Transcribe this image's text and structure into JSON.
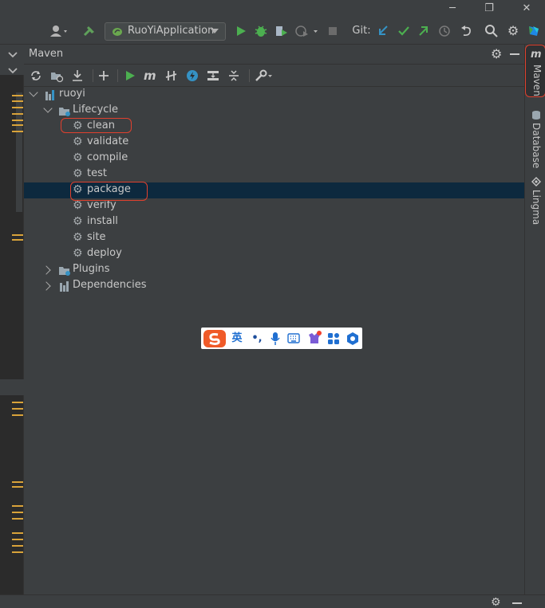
{
  "window": {
    "minimize_glyph": "─",
    "restore_glyph": "❐",
    "close_glyph": "✕"
  },
  "toolbar": {
    "run_config_label": "RuoYiApplication",
    "git_label": "Git:"
  },
  "tool_window": {
    "title": "Maven"
  },
  "tree": {
    "root": "ruoyi",
    "lifecycle": "Lifecycle",
    "goals": [
      "clean",
      "validate",
      "compile",
      "test",
      "package",
      "verify",
      "install",
      "site",
      "deploy"
    ],
    "plugins": "Plugins",
    "dependencies": "Dependencies",
    "selected_goal": "package"
  },
  "right_strip": {
    "tabs": [
      "Maven",
      "Database",
      "Lingma"
    ]
  },
  "ime": {
    "lang": "英",
    "punct": "•,"
  },
  "colors": {
    "accent_run": "#4caf50",
    "selection": "#0d293e",
    "highlight_circle": "#e0402e",
    "gutter_mark": "#d9a33a"
  }
}
